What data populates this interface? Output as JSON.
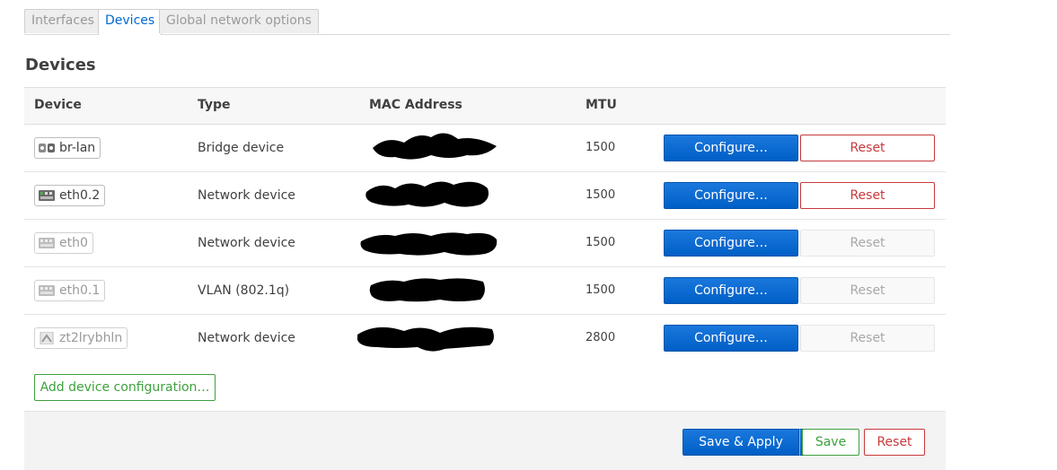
{
  "tabs": [
    {
      "label": "Interfaces",
      "active": false
    },
    {
      "label": "Devices",
      "active": true
    },
    {
      "label": "Global network options",
      "active": false
    }
  ],
  "section_title": "Devices",
  "table": {
    "headers": {
      "device": "Device",
      "type": "Type",
      "mac": "MAC Address",
      "mtu": "MTU"
    },
    "rows": [
      {
        "device": "br-lan",
        "icon": "bridge-icon",
        "active": true,
        "type": "Bridge device",
        "mac_redacted": true,
        "mtu": "1500",
        "configure_label": "Configure…",
        "reset_label": "Reset",
        "reset_enabled": true
      },
      {
        "device": "eth0.2",
        "icon": "ethernet-icon",
        "active": true,
        "type": "Network device",
        "mac_redacted": true,
        "mtu": "1500",
        "configure_label": "Configure…",
        "reset_label": "Reset",
        "reset_enabled": true
      },
      {
        "device": "eth0",
        "icon": "ethernet-icon",
        "active": false,
        "type": "Network device",
        "mac_redacted": true,
        "mtu": "1500",
        "configure_label": "Configure…",
        "reset_label": "Reset",
        "reset_enabled": false
      },
      {
        "device": "eth0.1",
        "icon": "ethernet-icon",
        "active": false,
        "type": "VLAN (802.1q)",
        "mac_redacted": true,
        "mtu": "1500",
        "configure_label": "Configure…",
        "reset_label": "Reset",
        "reset_enabled": false
      },
      {
        "device": "zt2lrybhln",
        "icon": "tunnel-icon",
        "active": false,
        "type": "Network device",
        "mac_redacted": true,
        "mtu": "2800",
        "configure_label": "Configure…",
        "reset_label": "Reset",
        "reset_enabled": false
      }
    ]
  },
  "add_device_label": "Add device configuration…",
  "footer": {
    "save_apply_label": "Save & Apply",
    "dropdown_glyph": "▾",
    "save_label": "Save",
    "reset_label": "Reset"
  },
  "colors": {
    "primary": "#0069d6",
    "positive": "#3ea13e",
    "negative": "#c7393b"
  }
}
